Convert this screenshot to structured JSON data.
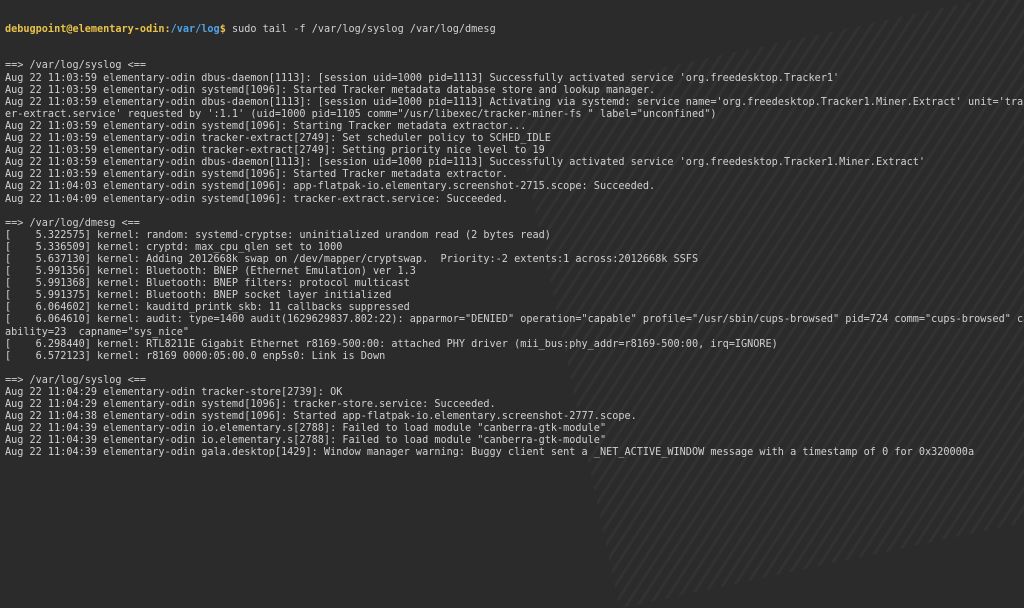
{
  "prompt": {
    "user_host": "debugpoint@elementary-odin",
    "separator": ":",
    "path": "/var/log",
    "dollar": "$",
    "command": " sudo tail -f /var/log/syslog /var/log/dmesg"
  },
  "sections": [
    {
      "header": "==> /var/log/syslog <==",
      "lines": [
        "Aug 22 11:03:59 elementary-odin dbus-daemon[1113]: [session uid=1000 pid=1113] Successfully activated service 'org.freedesktop.Tracker1'",
        "Aug 22 11:03:59 elementary-odin systemd[1096]: Started Tracker metadata database store and lookup manager.",
        "Aug 22 11:03:59 elementary-odin dbus-daemon[1113]: [session uid=1000 pid=1113] Activating via systemd: service name='org.freedesktop.Tracker1.Miner.Extract' unit='track",
        "er-extract.service' requested by ':1.1' (uid=1000 pid=1105 comm=\"/usr/libexec/tracker-miner-fs \" label=\"unconfined\")",
        "Aug 22 11:03:59 elementary-odin systemd[1096]: Starting Tracker metadata extractor...",
        "Aug 22 11:03:59 elementary-odin tracker-extract[2749]: Set scheduler policy to SCHED_IDLE",
        "Aug 22 11:03:59 elementary-odin tracker-extract[2749]: Setting priority nice level to 19",
        "Aug 22 11:03:59 elementary-odin dbus-daemon[1113]: [session uid=1000 pid=1113] Successfully activated service 'org.freedesktop.Tracker1.Miner.Extract'",
        "Aug 22 11:03:59 elementary-odin systemd[1096]: Started Tracker metadata extractor.",
        "Aug 22 11:04:03 elementary-odin systemd[1096]: app-flatpak-io.elementary.screenshot-2715.scope: Succeeded.",
        "Aug 22 11:04:09 elementary-odin systemd[1096]: tracker-extract.service: Succeeded."
      ]
    },
    {
      "header": "==> /var/log/dmesg <==",
      "lines": [
        "[    5.322575] kernel: random: systemd-cryptse: uninitialized urandom read (2 bytes read)",
        "[    5.336509] kernel: cryptd: max_cpu_qlen set to 1000",
        "[    5.637130] kernel: Adding 2012668k swap on /dev/mapper/cryptswap.  Priority:-2 extents:1 across:2012668k SSFS",
        "[    5.991356] kernel: Bluetooth: BNEP (Ethernet Emulation) ver 1.3",
        "[    5.991368] kernel: Bluetooth: BNEP filters: protocol multicast",
        "[    5.991375] kernel: Bluetooth: BNEP socket layer initialized",
        "[    6.064602] kernel: kauditd_printk_skb: 11 callbacks suppressed",
        "[    6.064610] kernel: audit: type=1400 audit(1629629837.802:22): apparmor=\"DENIED\" operation=\"capable\" profile=\"/usr/sbin/cups-browsed\" pid=724 comm=\"cups-browsed\" cap",
        "ability=23  capname=\"sys_nice\"",
        "[    6.298440] kernel: RTL8211E Gigabit Ethernet r8169-500:00: attached PHY driver (mii_bus:phy_addr=r8169-500:00, irq=IGNORE)",
        "[    6.572123] kernel: r8169 0000:05:00.0 enp5s0: Link is Down"
      ]
    },
    {
      "header": "==> /var/log/syslog <==",
      "lines": [
        "Aug 22 11:04:29 elementary-odin tracker-store[2739]: OK",
        "Aug 22 11:04:29 elementary-odin systemd[1096]: tracker-store.service: Succeeded.",
        "Aug 22 11:04:38 elementary-odin systemd[1096]: Started app-flatpak-io.elementary.screenshot-2777.scope.",
        "Aug 22 11:04:39 elementary-odin io.elementary.s[2788]: Failed to load module \"canberra-gtk-module\"",
        "Aug 22 11:04:39 elementary-odin io.elementary.s[2788]: Failed to load module \"canberra-gtk-module\"",
        "Aug 22 11:04:39 elementary-odin gala.desktop[1429]: Window manager warning: Buggy client sent a _NET_ACTIVE_WINDOW message with a timestamp of 0 for 0x320000a"
      ]
    }
  ]
}
